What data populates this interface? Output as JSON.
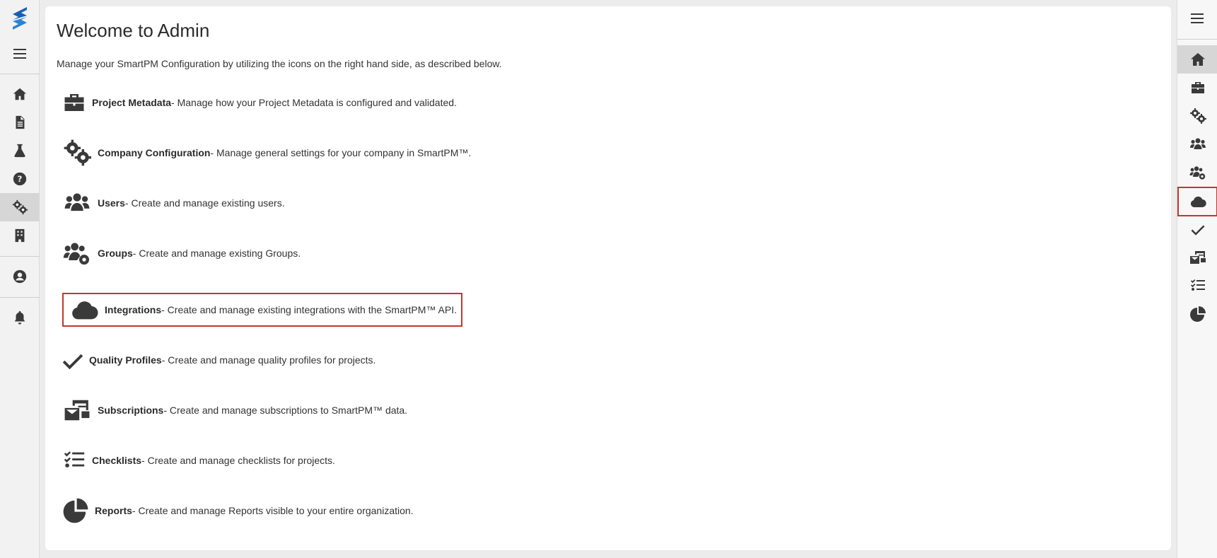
{
  "main": {
    "title": "Welcome to Admin",
    "intro": "Manage your SmartPM Configuration by utilizing the icons on the right hand side, as described below.",
    "items": [
      {
        "name": "Project Metadata",
        "desc": "- Manage how your Project Metadata is configured and validated.",
        "icon": "briefcase-icon"
      },
      {
        "name": "Company Configuration",
        "desc": "- Manage general settings for your company in SmartPM™.",
        "icon": "gears-icon"
      },
      {
        "name": "Users",
        "desc": "- Create and manage existing users.",
        "icon": "users-icon"
      },
      {
        "name": "Groups",
        "desc": "- Create and manage existing Groups.",
        "icon": "users-gear-icon"
      },
      {
        "name": "Integrations",
        "desc": "- Create and manage existing integrations with the SmartPM™ API.",
        "icon": "cloud-icon"
      },
      {
        "name": "Quality Profiles",
        "desc": "- Create and manage quality profiles for projects.",
        "icon": "check-icon"
      },
      {
        "name": "Subscriptions",
        "desc": "- Create and manage subscriptions to SmartPM™ data.",
        "icon": "envelope-card-icon"
      },
      {
        "name": "Checklists",
        "desc": "- Create and manage checklists for projects.",
        "icon": "list-check-icon"
      },
      {
        "name": "Reports",
        "desc": "- Create and manage Reports visible to your entire organization.",
        "icon": "pie-chart-icon"
      }
    ]
  },
  "left_nav": [
    "menu-icon",
    "home-icon",
    "file-icon",
    "flask-icon",
    "help-icon",
    "gears-icon",
    "building-icon",
    "user-icon",
    "bell-icon"
  ],
  "right_rail": [
    "menu-icon",
    "home-icon",
    "briefcase-icon",
    "gears-icon",
    "users-icon",
    "users-gear-icon",
    "cloud-icon",
    "check-icon",
    "envelope-card-icon",
    "list-check-icon",
    "pie-chart-icon"
  ],
  "colors": {
    "highlight": "#c0392b",
    "icon": "#3a3a3a",
    "brand": "#1a5fb4"
  }
}
